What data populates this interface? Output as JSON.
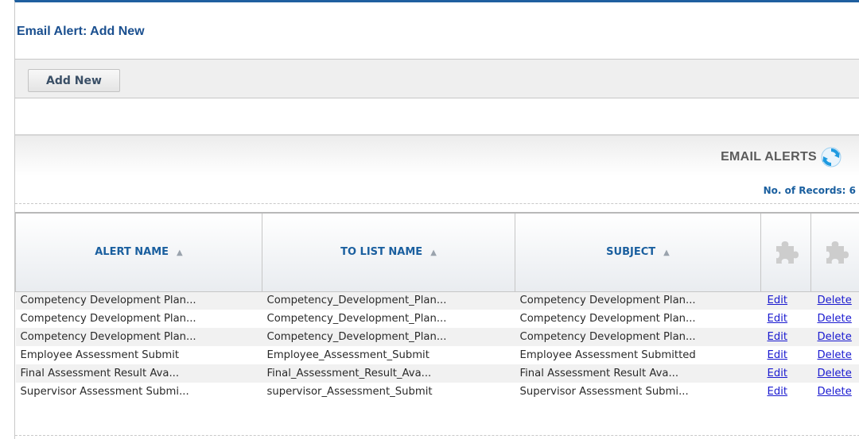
{
  "page": {
    "title": "Email Alert: Add New"
  },
  "toolbar": {
    "add_new_label": "Add New"
  },
  "section": {
    "title": "EMAIL ALERTS",
    "records_label": "No. of Records:",
    "records_count": "6"
  },
  "table": {
    "columns": [
      "ALERT NAME",
      "TO LIST NAME",
      "SUBJECT"
    ],
    "sort_arrow": "▲",
    "rows": [
      {
        "alert_name": "Competency Development Plan...",
        "to_list": "Competency_Development_Plan...",
        "subject": "Competency Development Plan...",
        "edit": "Edit",
        "delete": "Delete"
      },
      {
        "alert_name": "Competency Development Plan...",
        "to_list": "Competency_Development_Plan...",
        "subject": "Competency Development Plan...",
        "edit": "Edit",
        "delete": "Delete"
      },
      {
        "alert_name": "Competency Development Plan...",
        "to_list": "Competency_Development_Plan...",
        "subject": "Competency Development Plan...",
        "edit": "Edit",
        "delete": "Delete"
      },
      {
        "alert_name": "Employee Assessment Submit",
        "to_list": "Employee_Assessment_Submit",
        "subject": "Employee Assessment Submitted",
        "edit": "Edit",
        "delete": "Delete"
      },
      {
        "alert_name": "Final Assessment Result Ava...",
        "to_list": "Final_Assessment_Result_Ava...",
        "subject": "Final Assessment Result Ava...",
        "edit": "Edit",
        "delete": "Delete"
      },
      {
        "alert_name": "Supervisor Assessment Submi...",
        "to_list": "supervisor_Assessment_Submit",
        "subject": "Supervisor Assessment Submi...",
        "edit": "Edit",
        "delete": "Delete"
      }
    ]
  },
  "icons": {
    "refresh": "refresh-icon",
    "column_action": "puzzle-piece-icon"
  },
  "colors": {
    "accent": "#1f5f9f",
    "link": "#1a1ad0",
    "header_text": "#1a5f9f"
  }
}
